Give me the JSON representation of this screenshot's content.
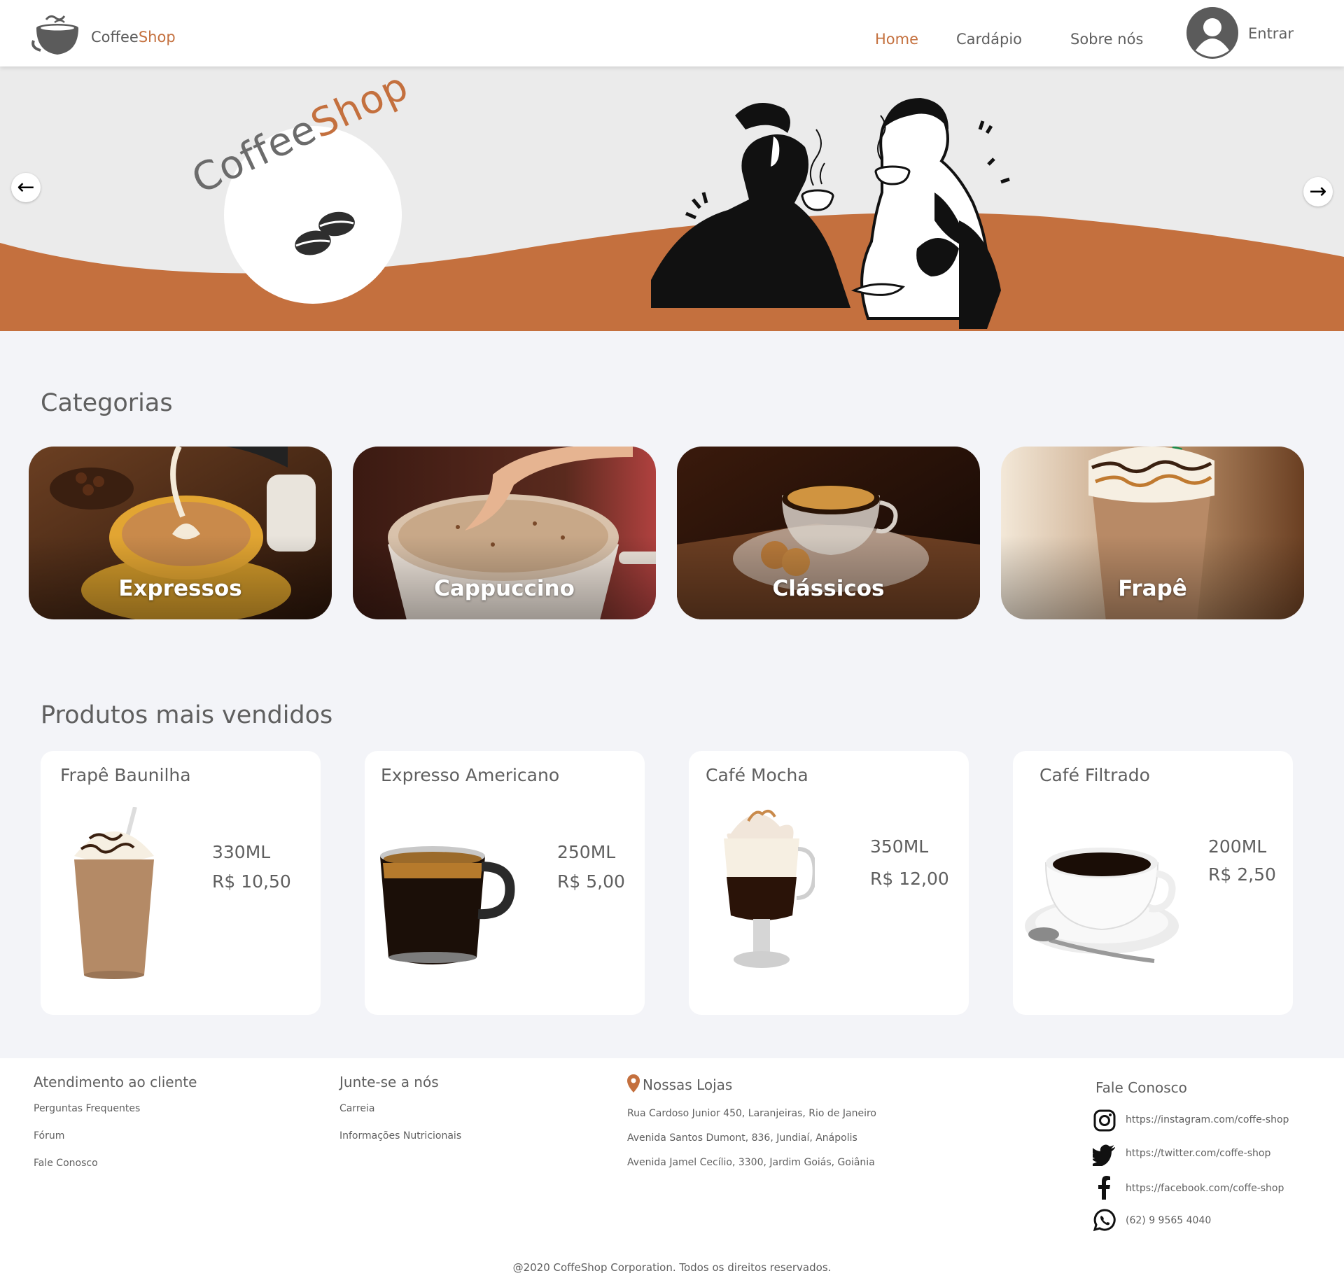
{
  "header": {
    "brand_part1": "Coffee",
    "brand_part2": "Shop",
    "nav": [
      "Home",
      "Cardápio",
      "Sobre nós"
    ],
    "login_label": "Entrar"
  },
  "hero": {
    "badge_part1": "Coffee",
    "badge_part2": "Shop"
  },
  "categories": {
    "title": "Categorias",
    "items": [
      "Expressos",
      "Cappuccino",
      "Clássicos",
      "Frapê"
    ]
  },
  "bestsellers": {
    "title": "Produtos mais vendidos",
    "items": [
      {
        "name": "Frapê Baunilha",
        "size": "330ML",
        "price": "R$ 10,50"
      },
      {
        "name": "Expresso Americano",
        "size": "250ML",
        "price": "R$ 5,00"
      },
      {
        "name": "Café Mocha",
        "size": "350ML",
        "price": "R$ 12,00"
      },
      {
        "name": "Café Filtrado",
        "size": "200ML",
        "price": "R$ 2,50"
      }
    ]
  },
  "footer": {
    "customer_service": {
      "title": "Atendimento ao cliente",
      "links": [
        "Perguntas Frequentes",
        "Fórum",
        "Fale Conosco"
      ]
    },
    "join": {
      "title": "Junte-se a nós",
      "links": [
        "Carreia",
        "Informações Nutricionais"
      ]
    },
    "stores": {
      "title": "Nossas Lojas",
      "addresses": [
        "Rua Cardoso Junior 450, Laranjeiras, Rio de Janeiro",
        "Avenida Santos Dumont, 836, Jundiaí, Anápolis",
        "Avenida Jamel Cecílio, 3300, Jardim Goiás, Goiânia"
      ]
    },
    "contact": {
      "title": "Fale Conosco",
      "instagram": "https://instagram.com/coffe-shop",
      "twitter": "https://twitter.com/coffe-shop",
      "facebook": "https://facebook.com/coffe-shop",
      "whatsapp": "(62) 9 9565 4040"
    },
    "copyright": "@2020 CoffeShop Corporation. Todos os direitos reservados."
  },
  "colors": {
    "accent": "#c4703e",
    "text": "#5f5f5f",
    "page_bg": "#f3f4f8",
    "hero_bg": "#ebebeb"
  },
  "icons": [
    "coffee-cup-logo-icon",
    "user-avatar-icon",
    "arrow-left-icon",
    "arrow-right-icon",
    "coffee-beans-icon",
    "location-pin-icon",
    "instagram-icon",
    "twitter-icon",
    "facebook-icon",
    "whatsapp-icon"
  ]
}
